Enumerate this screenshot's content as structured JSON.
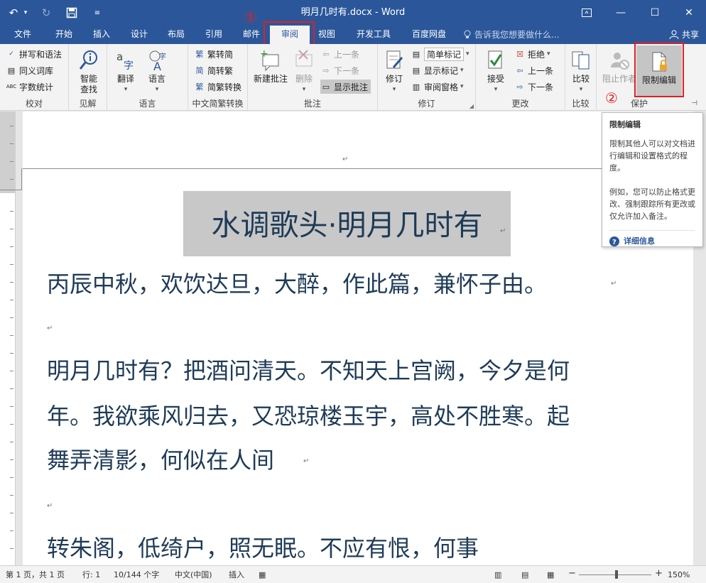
{
  "window": {
    "title": "明月几时有.docx - Word",
    "share_label": "共享"
  },
  "tabs": [
    {
      "label": "文件"
    },
    {
      "label": "开始"
    },
    {
      "label": "插入"
    },
    {
      "label": "设计"
    },
    {
      "label": "布局"
    },
    {
      "label": "引用"
    },
    {
      "label": "邮件"
    },
    {
      "label": "审阅",
      "active": true
    },
    {
      "label": "视图"
    },
    {
      "label": "开发工具"
    },
    {
      "label": "百度网盘"
    }
  ],
  "tell_me": "告诉我您想要做什么...",
  "annotations": {
    "step1": "①",
    "step2": "②",
    "color": "#e02020"
  },
  "ribbon": {
    "proofing": {
      "label": "校对",
      "spell": "拼写和语法",
      "thesaurus": "同义词库",
      "wordcount": "字数统计"
    },
    "insights": {
      "label": "见解",
      "smart_lookup": "智能\n查找"
    },
    "language": {
      "label": "语言",
      "translate": "翻译",
      "language": "语言"
    },
    "chinese": {
      "label": "中文简繁转换",
      "t2s": "繁转简",
      "s2t": "简转繁",
      "convert": "简繁转换"
    },
    "comments": {
      "label": "批注",
      "new": "新建批注",
      "delete": "删除",
      "prev": "上一条",
      "next": "下一条",
      "show": "显示批注"
    },
    "tracking": {
      "label": "修订",
      "track": "修订",
      "markup": "简单标记",
      "show_markup": "显示标记",
      "pane": "审阅窗格"
    },
    "changes": {
      "label": "更改",
      "accept": "接受",
      "reject": "拒绝",
      "prev": "上一条",
      "next": "下一条"
    },
    "compare": {
      "label": "比较",
      "compare": "比较"
    },
    "protect": {
      "label": "保护",
      "block_authors": "阻止作者",
      "restrict": "限制编辑"
    }
  },
  "tooltip": {
    "title": "限制编辑",
    "p1": "限制其他人可以对文档进行编辑和设置格式的程度。",
    "p2": "例如，您可以防止格式更改、强制跟踪所有更改或仅允许加入备注。",
    "link": "详细信息"
  },
  "document": {
    "title": "水调歌头·明月几时有",
    "lines": [
      "丙辰中秋，欢饮达旦，大醉，作此篇，兼怀子由。",
      "明月几时有？把酒问清天。不知天上宫阙，今夕是何",
      "年。我欲乘风归去，又恐琼楼玉宇，高处不胜寒。起",
      "舞弄清影，何似在人间",
      "转朱阁，低绮户，照无眠。不应有恨，何事"
    ],
    "para_mark": "↵",
    "text_color": "#1f3b57"
  },
  "status": {
    "page": "第 1 页，共 1 页",
    "line": "行: 1",
    "words": "10/144 个字",
    "lang": "中文(中国)",
    "mode": "插入",
    "zoom": "150%",
    "zoom_minus": "−",
    "zoom_plus": "+"
  },
  "theme": {
    "accent": "#2b579a"
  }
}
